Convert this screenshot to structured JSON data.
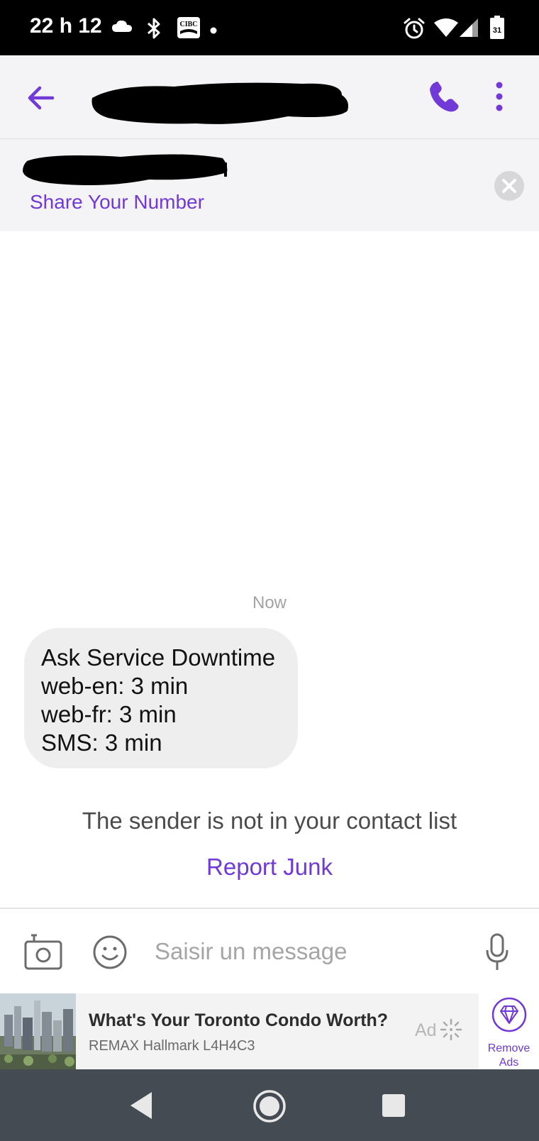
{
  "status_bar": {
    "time": "22 h 12",
    "icons": [
      "cloud-icon",
      "bluetooth-icon",
      "cibc-icon",
      "dot-icon",
      "alarm-icon",
      "wifi-icon",
      "signal-icon",
      "battery-icon"
    ],
    "cibc_label": "CIBC",
    "battery_label": "31"
  },
  "header": {
    "back_icon": "arrow-left-icon",
    "title_redacted": true,
    "call_icon": "phone-icon",
    "menu_icon": "more-vertical-icon",
    "accent_color": "#7139d8"
  },
  "share_banner": {
    "link_text": "Share Your Number",
    "close_icon": "close-icon"
  },
  "conversation": {
    "timestamp": "Now",
    "message_lines": [
      "Ask Service Downtime",
      "web-en: 3 min",
      "web-fr: 3 min",
      "SMS: 3 min"
    ],
    "sender_notice": "The sender is not in your contact list",
    "report_junk_label": "Report Junk"
  },
  "composer": {
    "placeholder": "Saisir un message",
    "camera_icon": "camera-icon",
    "emoji_icon": "emoji-icon",
    "mic_icon": "microphone-icon"
  },
  "ad": {
    "headline": "What's Your Toronto Condo Worth?",
    "subtext": "REMAX Hallmark L4H4C3",
    "badge": "Ad",
    "remove_label": "Remove\nAds",
    "remove_icon": "diamond-icon"
  },
  "nav_bar": {
    "icons": [
      "nav-back-icon",
      "nav-home-icon",
      "nav-recents-icon"
    ]
  }
}
